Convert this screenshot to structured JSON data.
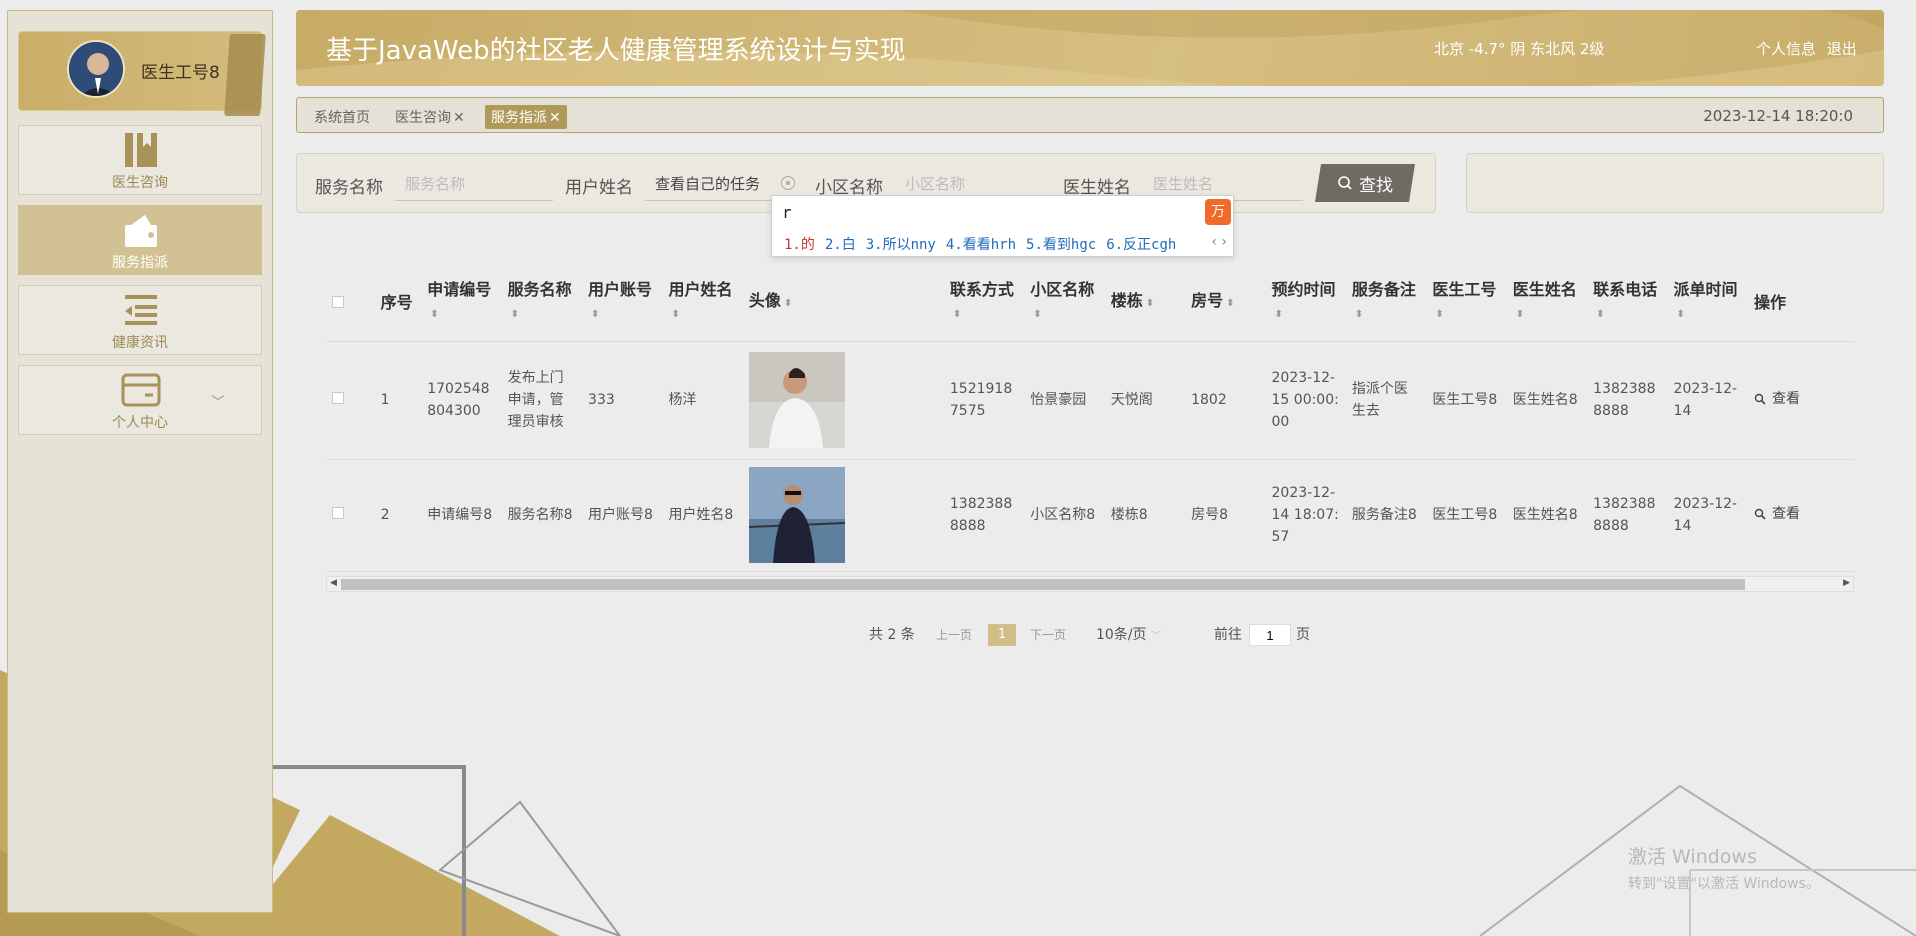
{
  "app": {
    "title": "基于JavaWeb的社区老人健康管理系统设计与实现",
    "weather": "北京  -4.7°  阴  东北风  2级",
    "profile_link": "个人信息",
    "logout_link": "退出"
  },
  "user": {
    "name": "医生工号8"
  },
  "sidebar": {
    "items": [
      {
        "label": "医生咨询",
        "icon": "book-icon"
      },
      {
        "label": "服务指派",
        "icon": "wallet-icon"
      },
      {
        "label": "健康资讯",
        "icon": "list-icon"
      },
      {
        "label": "个人中心",
        "icon": "card-icon"
      }
    ]
  },
  "tabs": {
    "home": "系统首页",
    "consult": "医生咨询",
    "assign": "服务指派",
    "close": "✕",
    "datetime": "2023-12-14 18:20:0"
  },
  "search": {
    "service_label": "服务名称",
    "service_placeholder": "服务名称",
    "user_label": "用户姓名",
    "user_value": "查看自己的任务",
    "community_label": "小区名称",
    "community_placeholder": "小区名称",
    "doctor_label": "医生姓名",
    "doctor_placeholder": "医生姓名",
    "button": "查找"
  },
  "ime": {
    "composition": "r",
    "candidates": [
      "1.的",
      "2.白",
      "3.所以nny",
      "4.看看hrh",
      "5.看到hgc",
      "6.反正cgh"
    ]
  },
  "table": {
    "headers": [
      "序号",
      "申请编号",
      "服务名称",
      "用户账号",
      "用户姓名",
      "头像",
      "联系方式",
      "小区名称",
      "楼栋",
      "房号",
      "预约时间",
      "服务备注",
      "医生工号",
      "医生姓名",
      "联系电话",
      "派单时间",
      "操作"
    ],
    "rows": [
      {
        "index": "1",
        "apply_no": "1702548804300",
        "service": "发布上门申请，管理员审核",
        "account": "333",
        "username": "杨洋",
        "phone": "15219187575",
        "community": "怡景豪园",
        "building": "天悦阁",
        "room": "1802",
        "appoint_time": "2023-12-15 00:00:00",
        "remark": "指派个医生去",
        "doctor_no": "医生工号8",
        "doctor_name": "医生姓名8",
        "doctor_phone": "13823888888",
        "dispatch_time": "2023-12-14",
        "action": "查看"
      },
      {
        "index": "2",
        "apply_no": "申请编号8",
        "service": "服务名称8",
        "account": "用户账号8",
        "username": "用户姓名8",
        "phone": "13823888888",
        "community": "小区名称8",
        "building": "楼栋8",
        "room": "房号8",
        "appoint_time": "2023-12-14 18:07:57",
        "remark": "服务备注8",
        "doctor_no": "医生工号8",
        "doctor_name": "医生姓名8",
        "doctor_phone": "13823888888",
        "dispatch_time": "2023-12-14",
        "action": "查看"
      }
    ]
  },
  "pager": {
    "total": "共 2 条",
    "prev": "上一页",
    "current": "1",
    "next": "下一页",
    "size": "10条/页",
    "goto": "前往",
    "goto_value": "1",
    "page_unit": "页"
  },
  "watermark": {
    "line1": "激活 Windows",
    "line2": "转到\"设置\"以激活 Windows。"
  },
  "colors": {
    "accent": "#c9ad68",
    "accent_dark": "#b09a5a"
  }
}
